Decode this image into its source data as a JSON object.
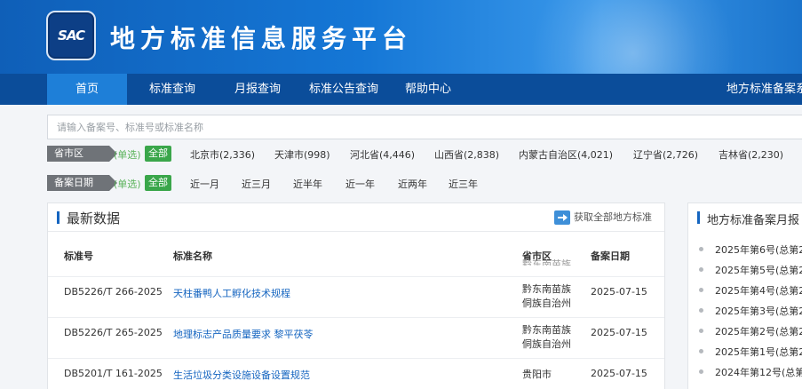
{
  "header": {
    "logo_text": "SAC",
    "site_title": "地方标准信息服务平台"
  },
  "nav": {
    "items": [
      "首页",
      "标准查询",
      "月报查询",
      "标准公告查询",
      "帮助中心"
    ],
    "active_index": 0,
    "right_item": "地方标准备案系"
  },
  "search": {
    "placeholder": "请输入备案号、标准号或标准名称"
  },
  "filters": {
    "region": {
      "label": "省市区",
      "mode": "(单选)",
      "all": "全部",
      "options": [
        "北京市(2,336)",
        "天津市(998)",
        "河北省(4,446)",
        "山西省(2,838)",
        "内蒙古自治区(4,021)",
        "辽宁省(2,726)",
        "吉林省(2,230)"
      ]
    },
    "date": {
      "label": "备案日期",
      "mode": "(单选)",
      "all": "全部",
      "options": [
        "近一月",
        "近三月",
        "近半年",
        "近一年",
        "近两年",
        "近三年"
      ]
    }
  },
  "latest": {
    "title": "最新数据",
    "more_link": "获取全部地方标准",
    "columns": [
      "标准号",
      "标准名称",
      "省市区",
      "备案日期"
    ],
    "partial_row_region": "黔东南苗族",
    "rows": [
      {
        "code": "DB5226/T 266-2025",
        "name": "天柱番鸭人工孵化技术规程",
        "region_line1": "黔东南苗族",
        "region_line2": "侗族自治州",
        "date": "2025-07-15"
      },
      {
        "code": "DB5226/T 265-2025",
        "name": "地理标志产品质量要求 黎平茯苓",
        "region_line1": "黔东南苗族",
        "region_line2": "侗族自治州",
        "date": "2025-07-15"
      },
      {
        "code": "DB5201/T 161-2025",
        "name": "生活垃圾分类设施设备设置规范",
        "region_line1": "贵阳市",
        "region_line2": "",
        "date": "2025-07-15"
      }
    ]
  },
  "monthly": {
    "title": "地方标准备案月报",
    "items": [
      "2025年第6号(总第2",
      "2025年第5号(总第2",
      "2025年第4号(总第2",
      "2025年第3号(总第2",
      "2025年第2号(总第2",
      "2025年第1号(总第2",
      "2024年第12号(总第"
    ]
  },
  "colors": {
    "banner": "#1577d6",
    "nav": "#0b4d9a",
    "nav_active": "#1e7fd8",
    "accent_green": "#3aa64a",
    "link_blue": "#1565c0"
  }
}
